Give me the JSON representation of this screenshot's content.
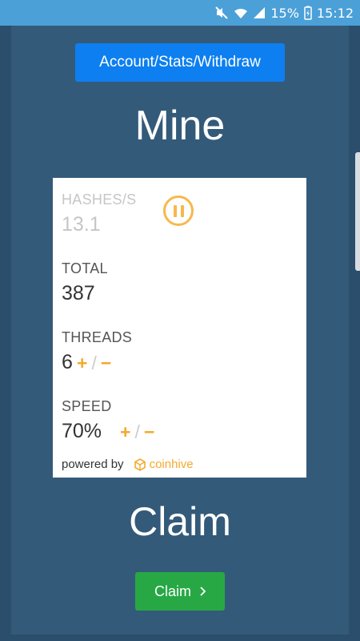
{
  "status_bar": {
    "battery_percent": "15%",
    "time": "15:12",
    "icons": [
      "mute-icon",
      "wifi-icon",
      "signal-icon",
      "battery-charging-icon"
    ]
  },
  "nav": {
    "label": "Account/Stats/Withdraw"
  },
  "mine": {
    "title": "Mine"
  },
  "miner": {
    "hashes": {
      "label": "HASHES/S",
      "value": "13.1"
    },
    "pause_icon": "pause-icon",
    "total": {
      "label": "TOTAL",
      "value": "387"
    },
    "threads": {
      "label": "THREADS",
      "value": "6"
    },
    "speed": {
      "label": "SPEED",
      "value": "70%"
    },
    "controls": {
      "plus": "+",
      "sep": "/",
      "minus": "−"
    },
    "powered": {
      "prefix": "powered by",
      "brand": "coinhive"
    }
  },
  "claim": {
    "title": "Claim",
    "button_label": "Claim",
    "button_icon": "chevron-right-icon"
  },
  "colors": {
    "background": "#345a7a",
    "frame": "#2a4e6c",
    "status_bar": "#4ba0d8",
    "nav_button": "#0d7ff0",
    "claim_button": "#27a844",
    "accent": "#f4a92c"
  }
}
